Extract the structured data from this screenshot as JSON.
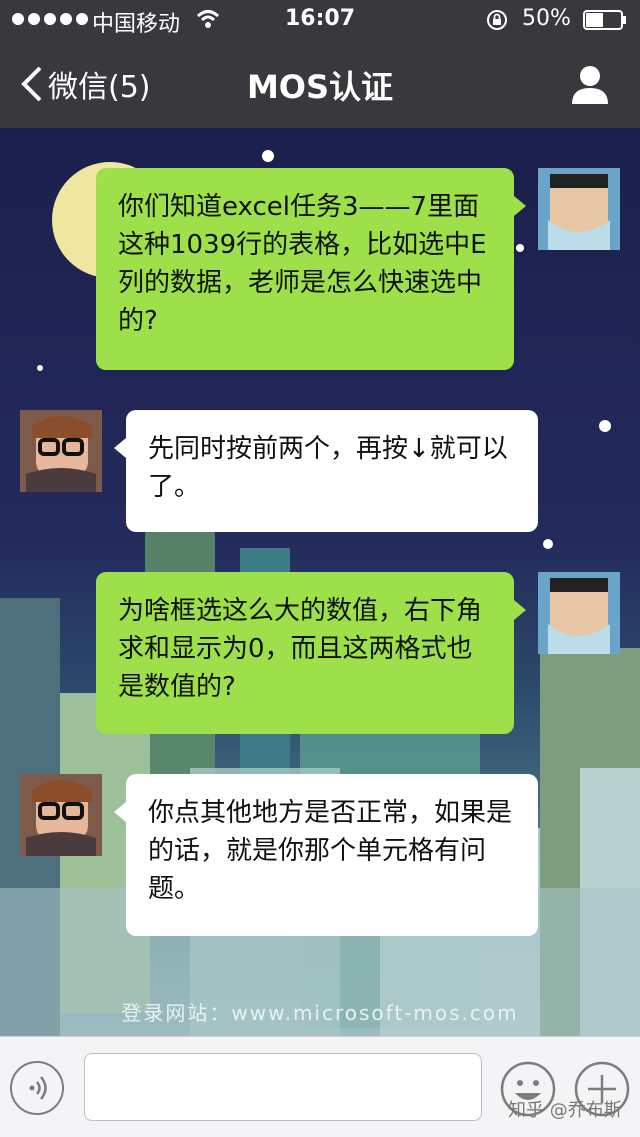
{
  "status": {
    "carrier": "中国移动",
    "time": "16:07",
    "battery": "50%",
    "battery_level": 0.5
  },
  "nav": {
    "back_label": "微信(5)",
    "title": "MOS认证"
  },
  "background": {
    "site_text": "登录网站：www.microsoft-mos.com"
  },
  "messages": [
    {
      "side": "me",
      "text": "你们知道excel任务3——7里面这种1039行的表格，比如选中E列的数据，老师是怎么快速选中的?"
    },
    {
      "side": "them",
      "text": "先同时按前两个，再按↓就可以了。"
    },
    {
      "side": "me",
      "text": "为啥框选这么大的数值，右下角求和显示为0，而且这两格式也是数值的?"
    },
    {
      "side": "them",
      "text": "你点其他地方是否正常，如果是的话，就是你那个单元格有问题。"
    }
  ],
  "input": {
    "placeholder": ""
  },
  "watermark": "知乎 @乔布斯",
  "colors": {
    "nav_bg": "#39393d",
    "my_bubble": "#9de04a",
    "their_bubble": "#ffffff",
    "input_bar": "#f4f4f6"
  }
}
